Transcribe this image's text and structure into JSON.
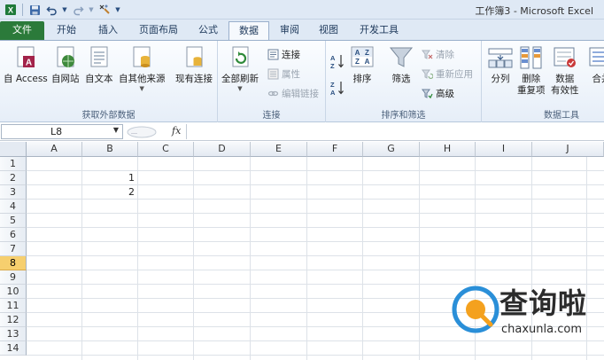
{
  "window": {
    "title": "工作簿3 - Microsoft Excel"
  },
  "tabs": [
    {
      "label": "文件"
    },
    {
      "label": "开始"
    },
    {
      "label": "插入"
    },
    {
      "label": "页面布局"
    },
    {
      "label": "公式"
    },
    {
      "label": "数据"
    },
    {
      "label": "审阅"
    },
    {
      "label": "视图"
    },
    {
      "label": "开发工具"
    }
  ],
  "active_tab": "数据",
  "ribbon": {
    "get_external": {
      "label": "获取外部数据",
      "buttons": [
        {
          "label": "自 Access"
        },
        {
          "label": "自网站"
        },
        {
          "label": "自文本"
        },
        {
          "label": "自其他来源"
        },
        {
          "label": "现有连接"
        }
      ]
    },
    "connections": {
      "label": "连接",
      "refresh_all": "全部刷新",
      "items": [
        {
          "label": "连接"
        },
        {
          "label": "属性"
        },
        {
          "label": "编辑链接"
        }
      ]
    },
    "sort_filter": {
      "label": "排序和筛选",
      "sort": "排序",
      "filter": "筛选",
      "items": [
        {
          "label": "清除"
        },
        {
          "label": "重新应用"
        },
        {
          "label": "高级"
        }
      ]
    },
    "data_tools": {
      "label": "数据工具",
      "buttons": [
        {
          "label": "分列"
        },
        {
          "label": "删除\n重复项"
        },
        {
          "label": "数据\n有效性"
        },
        {
          "label": "合并"
        }
      ]
    }
  },
  "formula_bar": {
    "name_box": "L8",
    "fx": "fx",
    "value": ""
  },
  "sheet": {
    "columns": [
      "A",
      "B",
      "C",
      "D",
      "E",
      "F",
      "G",
      "H",
      "I",
      "J"
    ],
    "rows": [
      "1",
      "2",
      "3",
      "4",
      "5",
      "6",
      "7",
      "8",
      "9",
      "10",
      "11",
      "12",
      "13",
      "14"
    ],
    "active_row": "8",
    "cells": [
      {
        "ref": "B2",
        "value": "1"
      },
      {
        "ref": "B3",
        "value": "2"
      }
    ]
  },
  "watermark": {
    "cn": "查询啦",
    "en": "chaxunla.com"
  },
  "colors": {
    "file_tab": "#2b7a3a",
    "active_row_header": "#f6cf6e",
    "ribbon_border": "#9ab0cc"
  }
}
